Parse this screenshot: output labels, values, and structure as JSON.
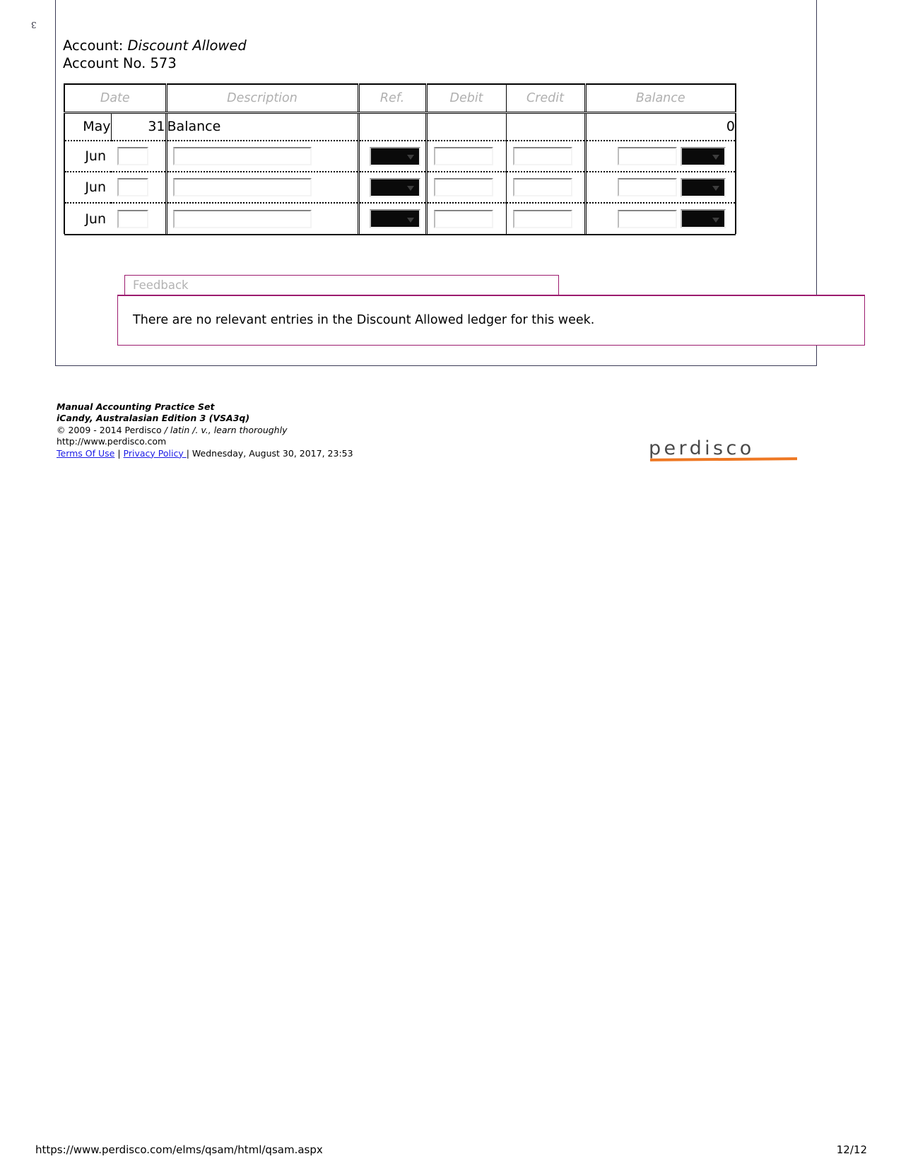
{
  "page_marker": "3",
  "account": {
    "label": "Account:",
    "name": "Discount Allowed",
    "number_label": "Account No.",
    "number": "573"
  },
  "ledger": {
    "headers": [
      "Date",
      "Description",
      "Ref.",
      "Debit",
      "Credit",
      "Balance"
    ],
    "opening_row": {
      "month": "May",
      "day": "31",
      "description": "Balance",
      "ref": "",
      "debit": "",
      "credit": "",
      "balance": "0"
    },
    "entry_rows": [
      {
        "month": "Jun",
        "day": "",
        "description": "",
        "ref": "",
        "debit": "",
        "credit": "",
        "balance": ""
      },
      {
        "month": "Jun",
        "day": "",
        "description": "",
        "ref": "",
        "debit": "",
        "credit": "",
        "balance": ""
      },
      {
        "month": "Jun",
        "day": "",
        "description": "",
        "ref": "",
        "debit": "",
        "credit": "",
        "balance": ""
      }
    ]
  },
  "feedback": {
    "tab_label": "Feedback",
    "message": "There are no relevant entries in the Discount Allowed ledger for this week."
  },
  "footer": {
    "line1": "Manual Accounting Practice Set",
    "line2": "iCandy, Australasian Edition 3 (VSA3q)",
    "copyright_prefix": "© 2009 - 2014 Perdisco ",
    "copyright_tagline": "/ latin /. v., learn thoroughly",
    "website": "http://www.perdisco.com",
    "terms_link": "Terms Of Use",
    "separator1": " | ",
    "privacy_link": "Privacy Policy ",
    "separator2": "| ",
    "timestamp": "Wednesday, August 30, 2017, 23:53",
    "logo_text": "perdisco"
  },
  "print_footer": {
    "url": "https://www.perdisco.com/elms/qsam/html/qsam.aspx",
    "page": "12/12"
  },
  "colors": {
    "accent_magenta": "#9c1b6e",
    "logo_orange": "#ee7722",
    "link_blue": "#1a1ae6",
    "header_gray": "#b0b0b0"
  }
}
